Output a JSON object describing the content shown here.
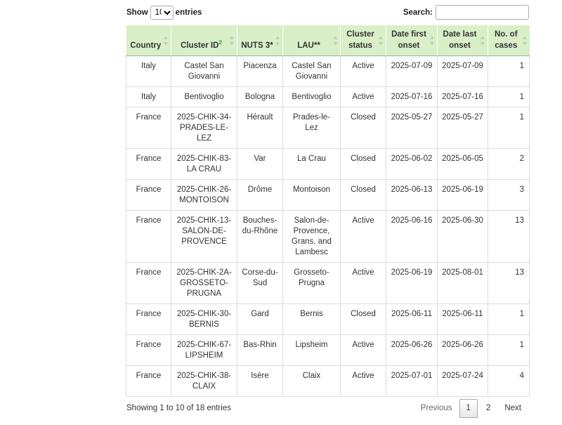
{
  "length": {
    "show_label": "Show",
    "selected": "10",
    "entries_label": "entries"
  },
  "search": {
    "label": "Search:",
    "value": ""
  },
  "columns": [
    {
      "label": "Country"
    },
    {
      "label": "Cluster ID",
      "footnote": "2"
    },
    {
      "label": "NUTS 3*"
    },
    {
      "label": "LAU**"
    },
    {
      "label": "Cluster status"
    },
    {
      "label": "Date first onset"
    },
    {
      "label": "Date last onset"
    },
    {
      "label": "No. of cases"
    }
  ],
  "rows": [
    [
      "Italy",
      "Castel San Giovanni",
      "Piacenza",
      "Castel San Giovanni",
      "Active",
      "2025-07-09",
      "2025-07-09",
      "1"
    ],
    [
      "Italy",
      "Bentivoglio",
      "Bologna",
      "Bentivoglio",
      "Active",
      "2025-07-16",
      "2025-07-16",
      "1"
    ],
    [
      "France",
      "2025-CHIK-34-PRADES-LE-LEZ",
      "Hérault",
      "Prades-le-Lez",
      "Closed",
      "2025-05-27",
      "2025-05-27",
      "1"
    ],
    [
      "France",
      "2025-CHIK-83-LA CRAU",
      "Var",
      "La Crau",
      "Closed",
      "2025-06-02",
      "2025-06-05",
      "2"
    ],
    [
      "France",
      "2025-CHIK-26-MONTOISON",
      "Drôme",
      "Montoison",
      "Closed",
      "2025-06-13",
      "2025-06-19",
      "3"
    ],
    [
      "France",
      "2025-CHIK-13-SALON-DE-PROVENCE",
      "Bouches-du-Rhône",
      "Salon-de-Provence, Grans, and Lambesc",
      "Active",
      "2025-06-16",
      "2025-06-30",
      "13"
    ],
    [
      "France",
      "2025-CHIK-2A-GROSSETO-PRUGNA",
      "Corse-du-Sud",
      "Grosseto-Prugna",
      "Active",
      "2025-06-19",
      "2025-08-01",
      "13"
    ],
    [
      "France",
      "2025-CHIK-30-BERNIS",
      "Gard",
      "Bernis",
      "Closed",
      "2025-06-11",
      "2025-06-11",
      "1"
    ],
    [
      "France",
      "2025-CHIK-67-LIPSHEIM",
      "Bas-Rhin",
      "Lipsheim",
      "Active",
      "2025-06-26",
      "2025-06-26",
      "1"
    ],
    [
      "France",
      "2025-CHIK-38-CLAIX",
      "Isère",
      "Claix",
      "Active",
      "2025-07-01",
      "2025-07-24",
      "4"
    ]
  ],
  "info": "Showing 1 to 10 of 18 entries",
  "pagination": {
    "previous": "Previous",
    "pages": [
      "1",
      "2"
    ],
    "current": "1",
    "next": "Next"
  },
  "colors": {
    "header_bg": "#d9efc8",
    "footnote": "#3a9b3a",
    "border": "#dcdcdc"
  }
}
